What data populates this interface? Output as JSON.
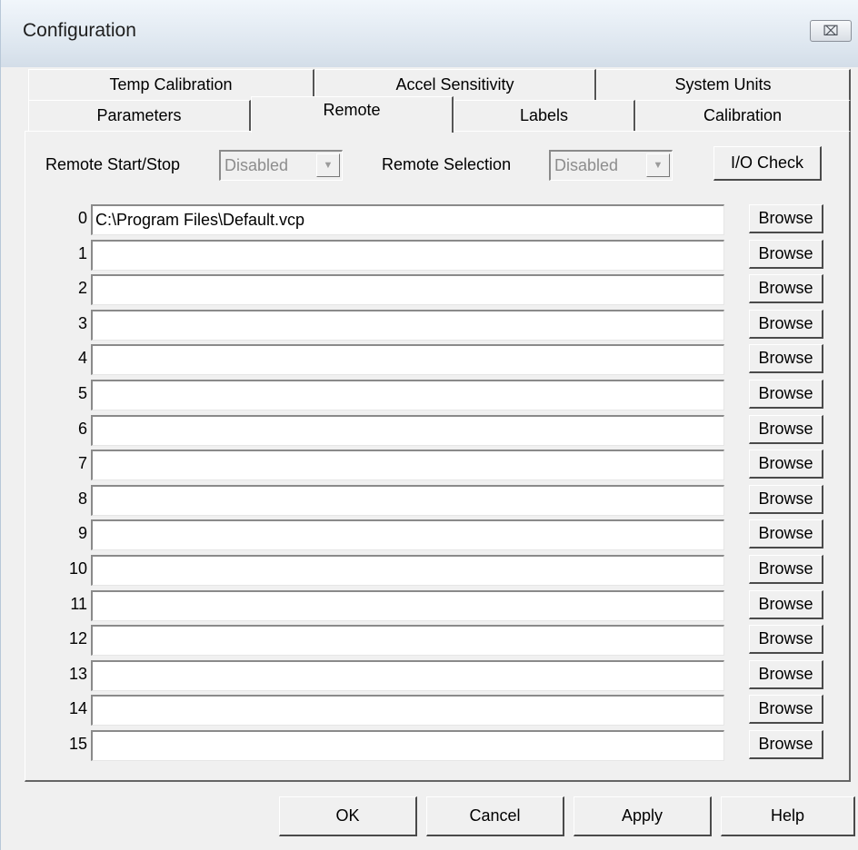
{
  "window": {
    "title": "Configuration",
    "close_glyph": "⌧"
  },
  "tabs": {
    "back_row": [
      "Temp Calibration",
      "Accel Sensitivity",
      "System Units"
    ],
    "front_row": [
      "Parameters",
      "Remote",
      "Labels",
      "Calibration"
    ],
    "active": "Remote"
  },
  "remote": {
    "start_stop_label": "Remote Start/Stop",
    "start_stop_value": "Disabled",
    "selection_label": "Remote Selection",
    "selection_value": "Disabled",
    "io_check_label": "I/O Check",
    "browse_label": "Browse",
    "rows": [
      {
        "num": "0",
        "path": "C:\\Program Files\\Default.vcp"
      },
      {
        "num": "1",
        "path": ""
      },
      {
        "num": "2",
        "path": ""
      },
      {
        "num": "3",
        "path": ""
      },
      {
        "num": "4",
        "path": ""
      },
      {
        "num": "5",
        "path": ""
      },
      {
        "num": "6",
        "path": ""
      },
      {
        "num": "7",
        "path": ""
      },
      {
        "num": "8",
        "path": ""
      },
      {
        "num": "9",
        "path": ""
      },
      {
        "num": "10",
        "path": ""
      },
      {
        "num": "11",
        "path": ""
      },
      {
        "num": "12",
        "path": ""
      },
      {
        "num": "13",
        "path": ""
      },
      {
        "num": "14",
        "path": ""
      },
      {
        "num": "15",
        "path": ""
      }
    ]
  },
  "footer": {
    "ok": "OK",
    "cancel": "Cancel",
    "apply": "Apply",
    "help": "Help"
  },
  "icons": {
    "close": "close-icon",
    "dropdown": "chevron-down-icon"
  },
  "colors": {
    "face": "#f0f0f0",
    "titlebar": "#dde6ef",
    "disabled_text": "#8d8d8d"
  }
}
